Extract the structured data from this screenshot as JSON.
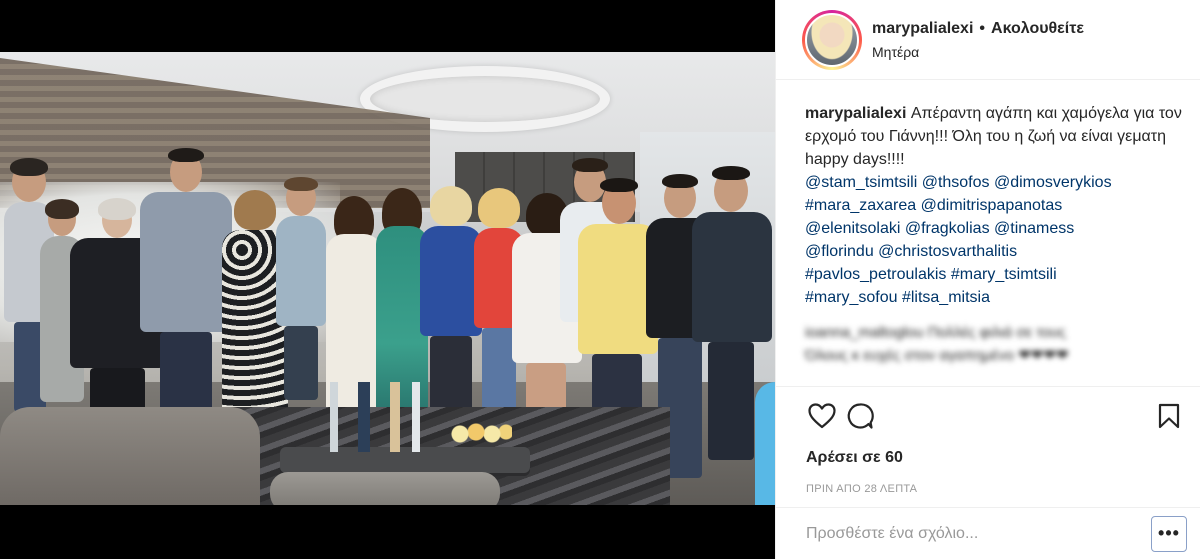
{
  "header": {
    "username": "marypalialexi",
    "separator": "•",
    "follow_label": "Ακολουθείτε",
    "location": "Μητέρα"
  },
  "caption": {
    "username": "marypalialexi",
    "text": "Απέραντη αγάπη και χαμόγελα για τον ερχομό του Γιάννη!!! Όλη του η ζωή να είναι γεματη happy days!!!!",
    "tags": [
      "@stam_tsimtsili @thsofos @dimosverykios",
      "#mara_zaxarea @dimitrispapanotas",
      "@elenitsolaki @fragkolias @tinamess",
      "@florindu @christosvarthalitis",
      "#pavlos_petroulakis #mary_tsimtsili",
      "#mary_sofou #litsa_mitsia"
    ]
  },
  "blurred_comment": {
    "line1": "ioanna_maltoglou Πολλές φιλιά σε τους",
    "line2": "Όλους κ ευχές στον αγαπημένο ❤❤❤❤"
  },
  "actions": {
    "like_icon": "heart-icon",
    "comment_icon": "comment-icon",
    "save_icon": "bookmark-icon",
    "likes_text": "Αρέσει σε 60",
    "timestamp": "ΠΡΙΝ ΑΠΟ 28 ΛΕΠΤΑ"
  },
  "add_comment": {
    "placeholder": "Προσθέστε ένα σχόλιο...",
    "more_label": "•••"
  },
  "colors": {
    "link": "#003569",
    "muted": "#999999",
    "text": "#262626",
    "border": "#efefef"
  }
}
